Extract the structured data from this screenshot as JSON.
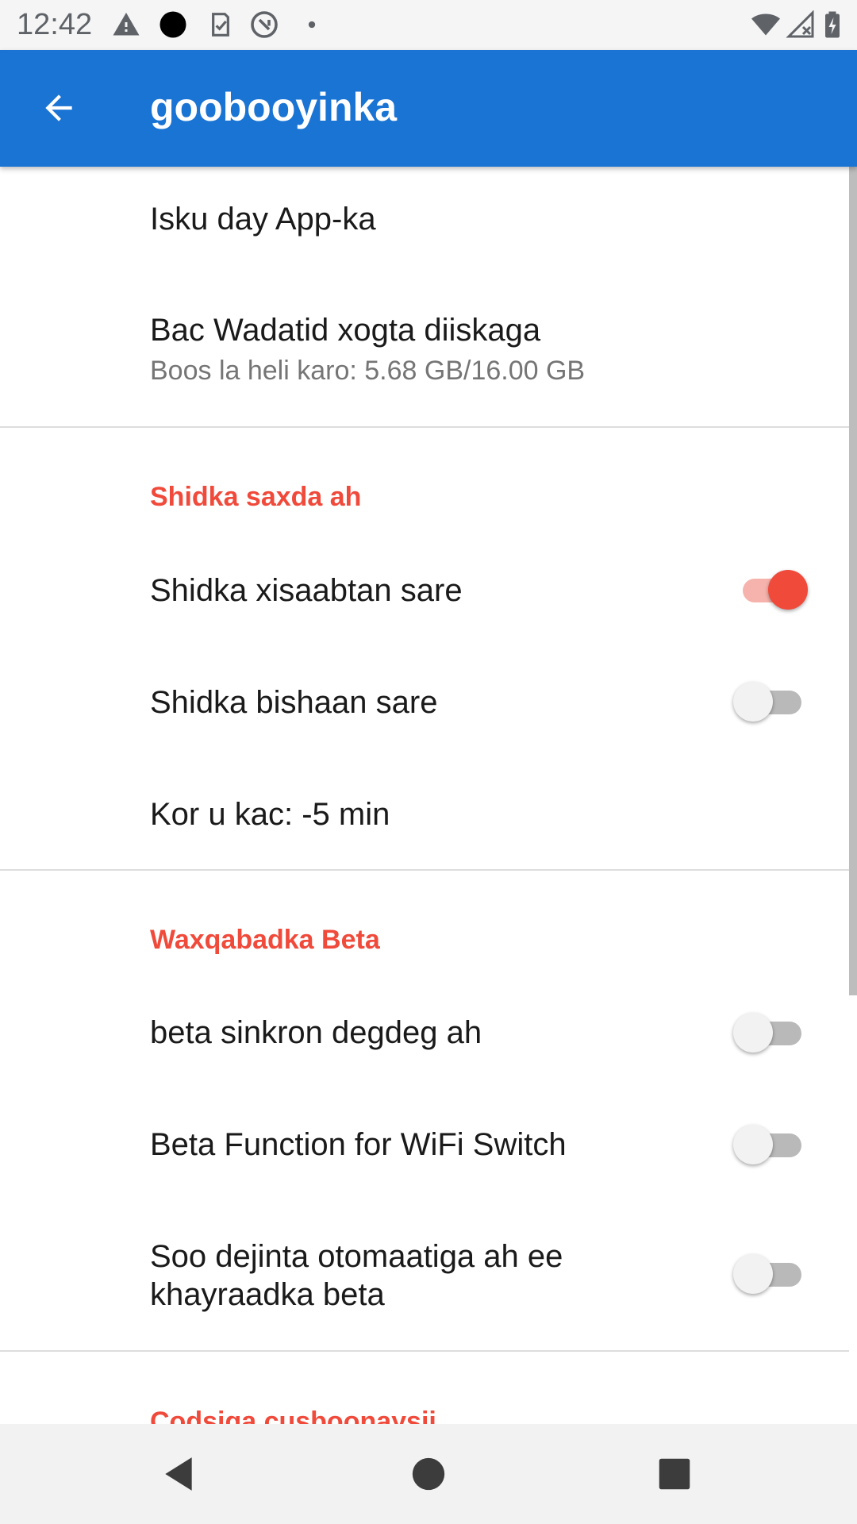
{
  "status_bar": {
    "time": "12:42",
    "left_icons": [
      "warning-icon",
      "circle-dot-icon",
      "clipboard-check-icon",
      "at-sign-icon",
      "small-dot-icon"
    ],
    "right_icons": [
      "wifi-icon",
      "cellular-no-signal-icon",
      "battery-icon"
    ]
  },
  "app_bar": {
    "title": "goobooyinka",
    "back_icon": "arrow-back-icon",
    "background_color": "#1a74d4"
  },
  "settings": {
    "try_app": {
      "title": "Isku day App-ka"
    },
    "storage": {
      "title": "Bac Wadatid xogta diiskaga",
      "summary": "Boos la heli karo: 5.68 GB/16.00 GB"
    },
    "cloud_sync_section": {
      "header": "Shidka saxda ah",
      "items": [
        {
          "title": "Shidka xisaabtan sare",
          "enabled": true
        },
        {
          "title": "Shidka bishaan sare",
          "enabled": false
        }
      ],
      "offset": {
        "title": "Kor u kac: -5 min"
      }
    },
    "beta_section": {
      "header": "Waxqabadka Beta",
      "items": [
        {
          "title": "beta sinkron degdeg ah",
          "enabled": false
        },
        {
          "title": "Beta Function for WiFi Switch",
          "enabled": false
        },
        {
          "title": "Soo dejinta otomaatiga ah ee khayraadka beta",
          "enabled": false
        }
      ]
    },
    "next_section": {
      "header": "Codsiga cusboonaysii"
    }
  },
  "accent_color": "#f04a3b",
  "nav_bar": {
    "buttons": [
      "back-triangle-icon",
      "home-circle-icon",
      "recents-square-icon"
    ]
  }
}
